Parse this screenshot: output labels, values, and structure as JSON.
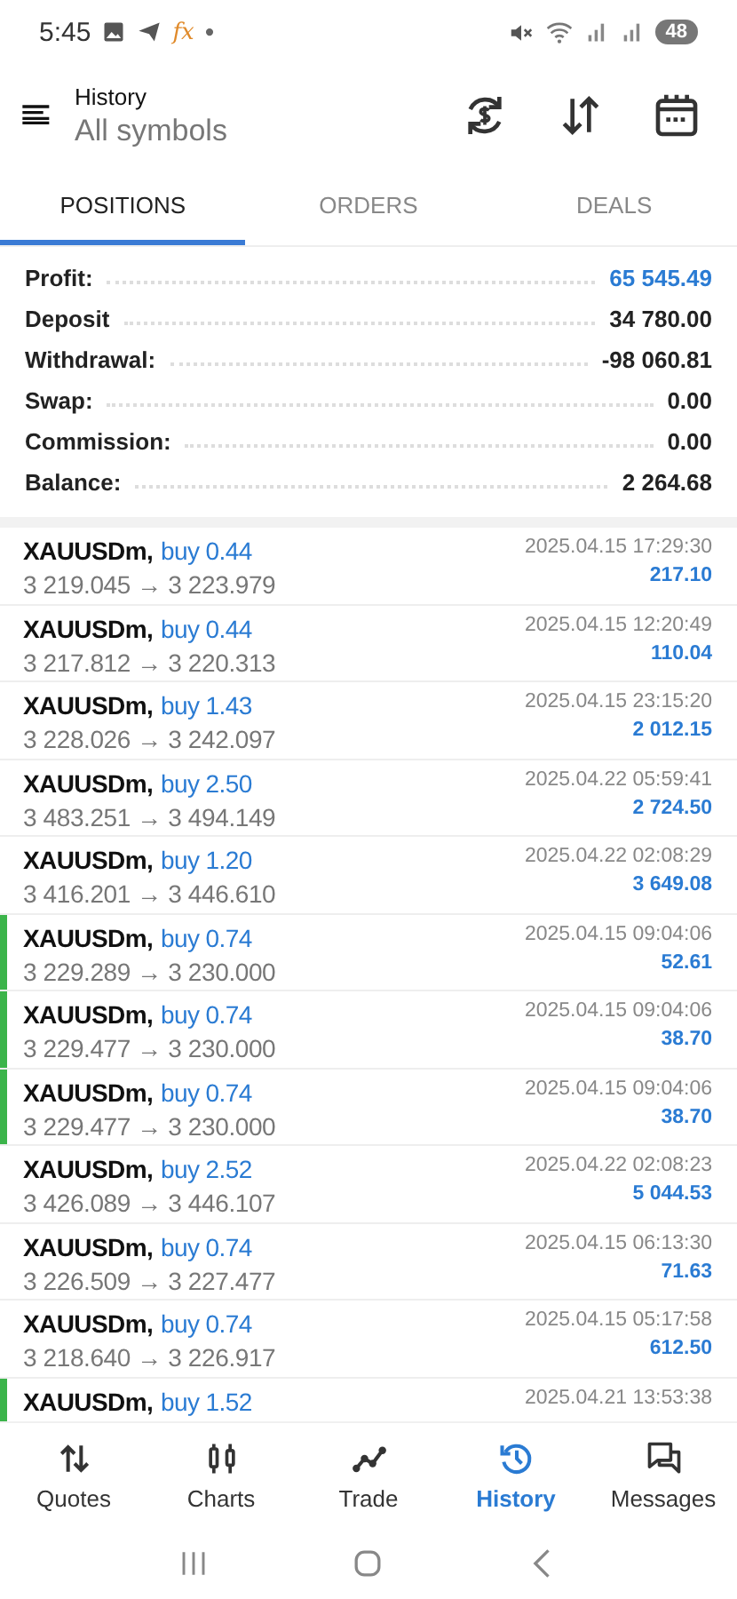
{
  "status_bar": {
    "time": "5:45",
    "app_mark": "fx",
    "dot": "•",
    "battery": "48"
  },
  "header": {
    "title": "History",
    "subtitle": "All symbols"
  },
  "tabs": [
    {
      "label": "POSITIONS",
      "selected": true
    },
    {
      "label": "ORDERS",
      "selected": false
    },
    {
      "label": "DEALS",
      "selected": false
    }
  ],
  "summary": [
    {
      "label": "Profit:",
      "value": "65 545.49",
      "accent": true
    },
    {
      "label": "Deposit",
      "value": "34 780.00",
      "accent": false
    },
    {
      "label": "Withdrawal:",
      "value": "-98 060.81",
      "accent": false
    },
    {
      "label": "Swap:",
      "value": "0.00",
      "accent": false
    },
    {
      "label": "Commission:",
      "value": "0.00",
      "accent": false
    },
    {
      "label": "Balance:",
      "value": "2 264.68",
      "accent": false
    }
  ],
  "positions": [
    {
      "symbol": "XAUUSDm,",
      "side": "buy 0.44",
      "prices": "3 219.045 → 3 223.979",
      "time": "2025.04.15 17:29:30",
      "profit": "217.10",
      "marked": false
    },
    {
      "symbol": "XAUUSDm,",
      "side": "buy 0.44",
      "prices": "3 217.812 → 3 220.313",
      "time": "2025.04.15 12:20:49",
      "profit": "110.04",
      "marked": false
    },
    {
      "symbol": "XAUUSDm,",
      "side": "buy 1.43",
      "prices": "3 228.026 → 3 242.097",
      "time": "2025.04.15 23:15:20",
      "profit": "2 012.15",
      "marked": false
    },
    {
      "symbol": "XAUUSDm,",
      "side": "buy 2.50",
      "prices": "3 483.251 → 3 494.149",
      "time": "2025.04.22 05:59:41",
      "profit": "2 724.50",
      "marked": false
    },
    {
      "symbol": "XAUUSDm,",
      "side": "buy 1.20",
      "prices": "3 416.201 → 3 446.610",
      "time": "2025.04.22 02:08:29",
      "profit": "3 649.08",
      "marked": false
    },
    {
      "symbol": "XAUUSDm,",
      "side": "buy 0.74",
      "prices": "3 229.289 → 3 230.000",
      "time": "2025.04.15 09:04:06",
      "profit": "52.61",
      "marked": true
    },
    {
      "symbol": "XAUUSDm,",
      "side": "buy 0.74",
      "prices": "3 229.477 → 3 230.000",
      "time": "2025.04.15 09:04:06",
      "profit": "38.70",
      "marked": true
    },
    {
      "symbol": "XAUUSDm,",
      "side": "buy 0.74",
      "prices": "3 229.477 → 3 230.000",
      "time": "2025.04.15 09:04:06",
      "profit": "38.70",
      "marked": true
    },
    {
      "symbol": "XAUUSDm,",
      "side": "buy 2.52",
      "prices": "3 426.089 → 3 446.107",
      "time": "2025.04.22 02:08:23",
      "profit": "5 044.53",
      "marked": false
    },
    {
      "symbol": "XAUUSDm,",
      "side": "buy 0.74",
      "prices": "3 226.509 → 3 227.477",
      "time": "2025.04.15 06:13:30",
      "profit": "71.63",
      "marked": false
    },
    {
      "symbol": "XAUUSDm,",
      "side": "buy 0.74",
      "prices": "3 218.640 → 3 226.917",
      "time": "2025.04.15 05:17:58",
      "profit": "612.50",
      "marked": false
    },
    {
      "symbol": "XAUUSDm,",
      "side": "buy 1.52",
      "time": "2025.04.21 13:53:38",
      "marked": true
    }
  ],
  "bottom_nav": [
    {
      "label": "Quotes",
      "selected": false
    },
    {
      "label": "Charts",
      "selected": false
    },
    {
      "label": "Trade",
      "selected": false
    },
    {
      "label": "History",
      "selected": true
    },
    {
      "label": "Messages",
      "selected": false
    }
  ]
}
